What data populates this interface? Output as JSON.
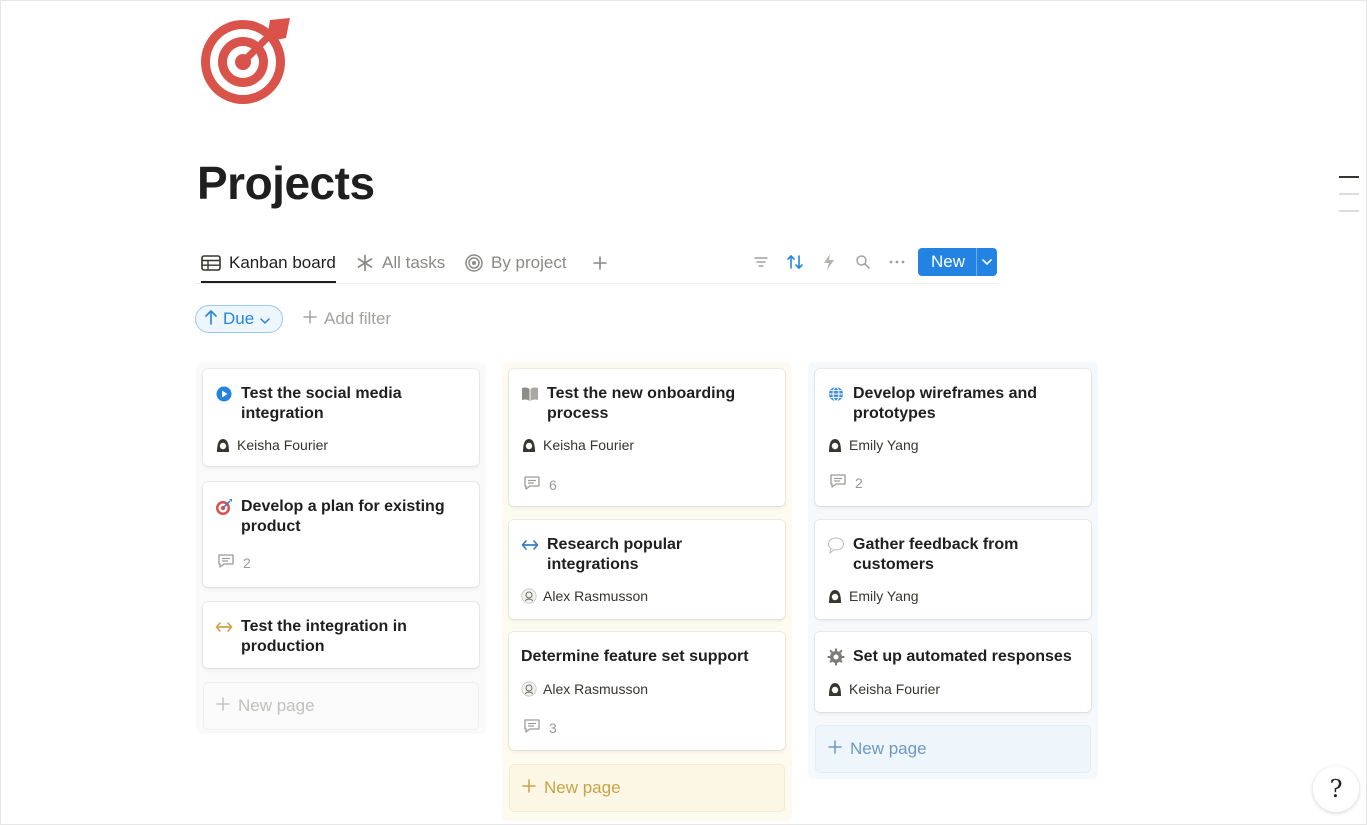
{
  "page": {
    "title": "Projects"
  },
  "tabs": [
    {
      "label": "Kanban board",
      "active": true,
      "icon": "table-icon"
    },
    {
      "label": "All tasks",
      "active": false,
      "icon": "asterisk-icon"
    },
    {
      "label": "By project",
      "active": false,
      "icon": "target-icon"
    }
  ],
  "toolbar": {
    "new_label": "New",
    "icons": [
      "filter-icon",
      "sort-icon",
      "automation-icon",
      "search-icon",
      "more-icon"
    ]
  },
  "filters": {
    "due_label": "Due",
    "add_filter_label": "Add filter"
  },
  "columns": [
    {
      "cards": [
        {
          "title": "Test the social media integration",
          "icon": "play-circle-icon",
          "assignee": "Keisha Fourier",
          "comments": null
        },
        {
          "title": "Develop a plan for existing product",
          "icon": "dart-target-icon",
          "assignee": null,
          "comments": "2"
        },
        {
          "title": "Test the integration in production",
          "icon": "arrows-horizontal-icon",
          "assignee": null,
          "comments": null
        }
      ],
      "new_page_label": "New page"
    },
    {
      "cards": [
        {
          "title": "Test the new onboarding process",
          "icon": "book-icon",
          "assignee": "Keisha Fourier",
          "comments": "6"
        },
        {
          "title": "Research popular integrations",
          "icon": "arrows-horizontal-icon",
          "assignee": "Alex Rasmusson",
          "comments": null
        },
        {
          "title": "Determine feature set support",
          "icon": null,
          "assignee": "Alex Rasmusson",
          "comments": "3"
        }
      ],
      "new_page_label": "New page"
    },
    {
      "cards": [
        {
          "title": "Develop wireframes and prototypes",
          "icon": "globe-icon",
          "assignee": "Emily Yang",
          "comments": "2"
        },
        {
          "title": "Gather feedback from customers",
          "icon": "speech-bubble-icon",
          "assignee": "Emily Yang",
          "comments": null
        },
        {
          "title": "Set up automated responses",
          "icon": "gear-icon",
          "assignee": "Keisha Fourier",
          "comments": null
        }
      ],
      "new_page_label": "New page"
    }
  ],
  "help": {
    "label": "?"
  },
  "colors": {
    "accent": "#2383e2",
    "title": "#1f1f1f",
    "target_red": "#d9534a"
  }
}
